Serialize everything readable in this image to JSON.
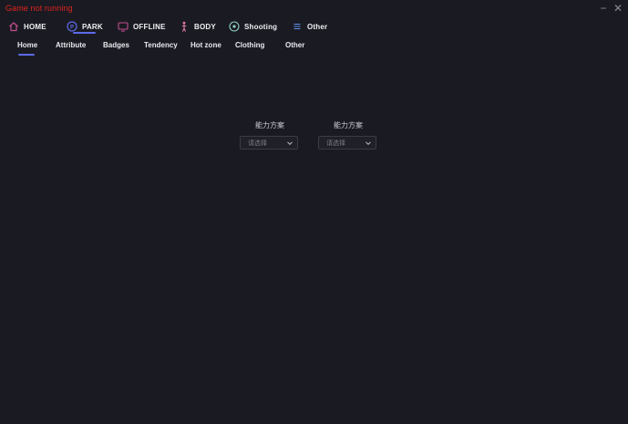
{
  "status": {
    "text": "Game not running",
    "color": "#e0211e"
  },
  "window_controls": {
    "minimize": "−",
    "close": "✕"
  },
  "top_nav": {
    "tabs": [
      {
        "label": "HOME",
        "icon": "home-icon"
      },
      {
        "label": "PARK",
        "icon": "park-icon"
      },
      {
        "label": "OFFLINE",
        "icon": "monitor-icon"
      },
      {
        "label": "BODY",
        "icon": "person-icon"
      },
      {
        "label": "Shooting",
        "icon": "target-icon"
      },
      {
        "label": "Other",
        "icon": "menu-icon"
      }
    ],
    "active": "PARK",
    "accent": "#5d6ae8"
  },
  "sub_nav": {
    "tabs": [
      "Home",
      "Attribute",
      "Badges",
      "Tendency",
      "Hot zone",
      "Clothing",
      "Other"
    ],
    "active": "Home"
  },
  "dropdowns": [
    {
      "label": "能力方案",
      "placeholder": "请选择"
    },
    {
      "label": "能力方案",
      "placeholder": "请选择"
    }
  ]
}
